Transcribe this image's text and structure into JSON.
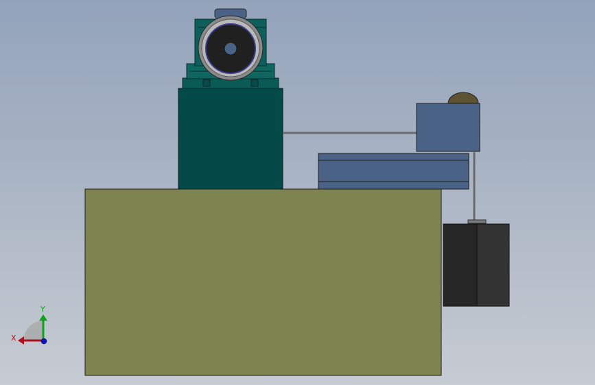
{
  "triad": {
    "x_label": "X",
    "y_label": "Y"
  },
  "colors": {
    "base_tank": "#7d8450",
    "motor_stand": "#034a48",
    "motor_body": "#0c5f5b",
    "manifold": "#4a6285",
    "accumulator": "#262626",
    "pipe": "#6a6a6a",
    "valve_cap": "#5d5330"
  }
}
